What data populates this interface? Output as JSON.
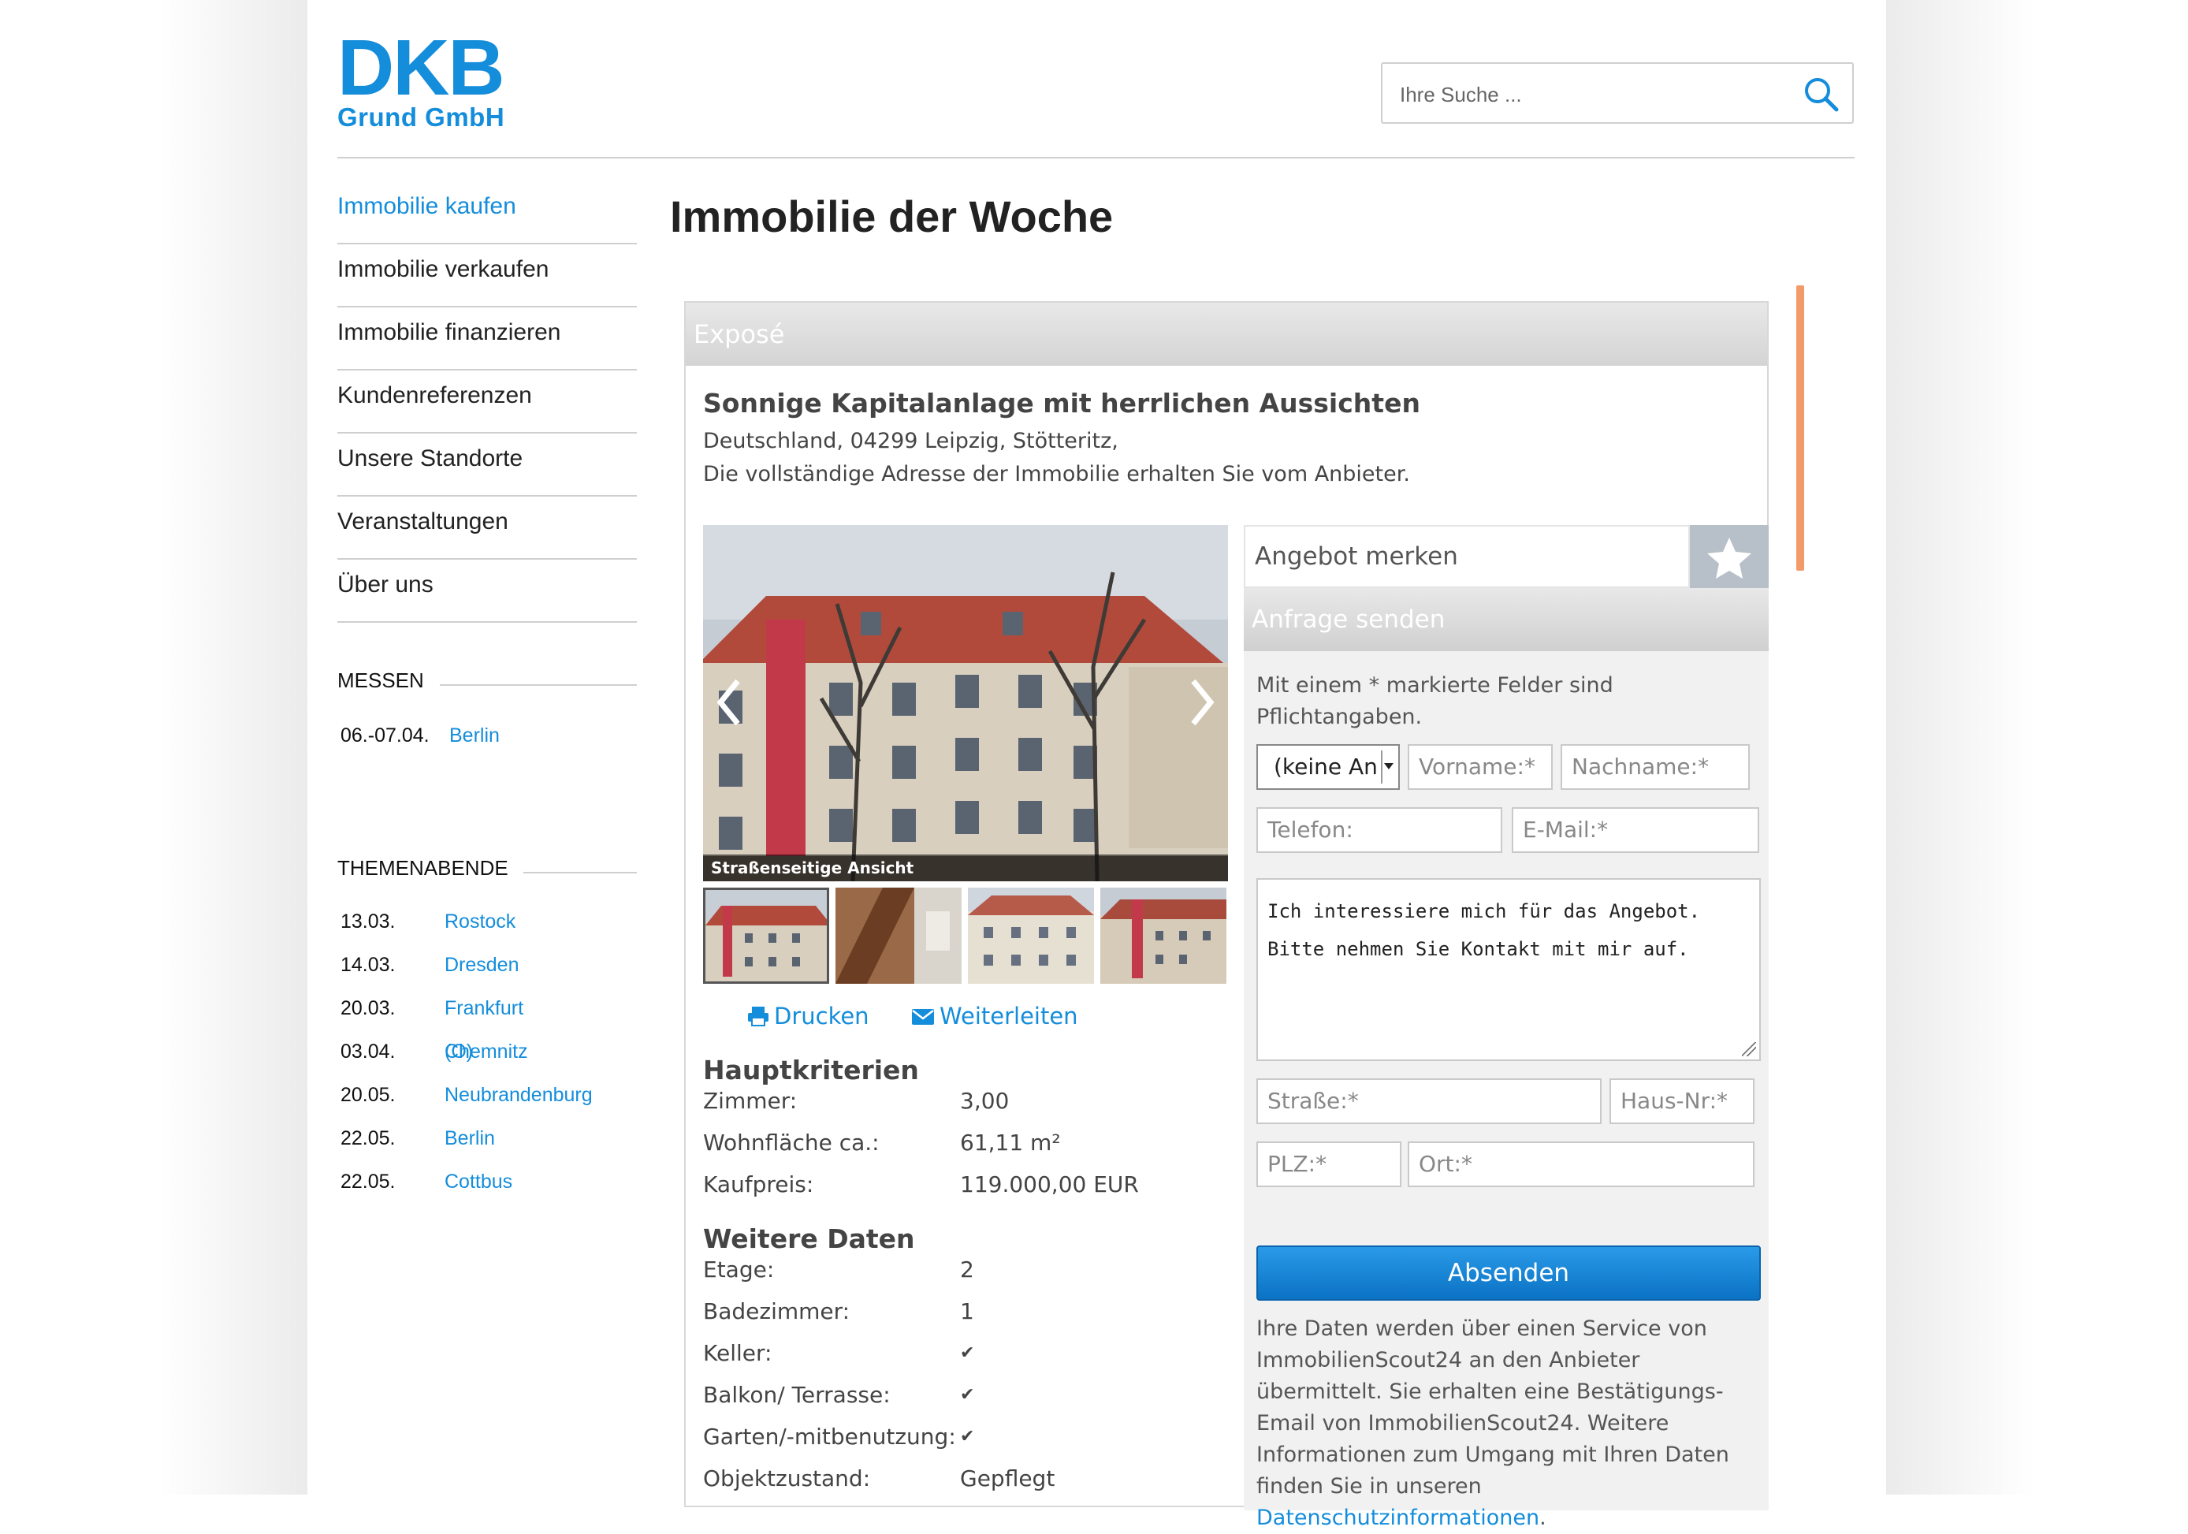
{
  "header": {
    "logo_main": "DKB",
    "logo_sub": "Grund GmbH",
    "search_placeholder": "Ihre Suche ..."
  },
  "nav": {
    "items": [
      {
        "label": "Immobilie kaufen",
        "active": true
      },
      {
        "label": "Immobilie verkaufen"
      },
      {
        "label": "Immobilie finanzieren"
      },
      {
        "label": "Kundenreferenzen"
      },
      {
        "label": "Unsere Standorte"
      },
      {
        "label": "Veranstaltungen"
      },
      {
        "label": "Über uns"
      }
    ]
  },
  "messen": {
    "heading": "MESSEN",
    "events": [
      {
        "date": "06.-07.04.",
        "city": "Berlin"
      }
    ]
  },
  "themenabende": {
    "heading": "THEMENABENDE",
    "events": [
      {
        "date": "13.03.",
        "city": "Rostock"
      },
      {
        "date": "14.03.",
        "city": "Dresden"
      },
      {
        "date": "20.03.",
        "city": "Frankfurt (O)"
      },
      {
        "date": "03.04.",
        "city": "Chemnitz"
      },
      {
        "date": "20.05.",
        "city": "Neubrandenburg"
      },
      {
        "date": "22.05.",
        "city": "Berlin"
      },
      {
        "date": "22.05.",
        "city": "Cottbus"
      }
    ]
  },
  "main": {
    "page_title": "Immobilie der Woche",
    "panel_header": "Exposé",
    "property_title": "Sonnige Kapitalanlage mit herrlichen Aussichten",
    "address": "Deutschland, 04299 Leipzig, Stötteritz,",
    "address_note": "Die vollständige Adresse der Immobilie erhalten Sie vom Anbieter.",
    "photo_caption": "Straßenseitige Ansicht",
    "print_label": "Drucken",
    "forward_label": "Weiterleiten",
    "haupt": {
      "heading": "Hauptkriterien",
      "rows": [
        {
          "key": "Zimmer:",
          "value": "3,00"
        },
        {
          "key": "Wohnfläche ca.:",
          "value": "61,11 m²"
        },
        {
          "key": "Kaufpreis:",
          "value": "119.000,00 EUR"
        }
      ]
    },
    "weitere": {
      "heading": "Weitere Daten",
      "rows": [
        {
          "key": "Etage:",
          "value": "2"
        },
        {
          "key": "Badezimmer:",
          "value": "1"
        },
        {
          "key": "Keller:",
          "value": "✔"
        },
        {
          "key": "Balkon/ Terrasse:",
          "value": "✔"
        },
        {
          "key": "Garten/-mitbenutzung:",
          "value": "✔"
        },
        {
          "key": "Objektzustand:",
          "value": "Gepflegt"
        }
      ]
    }
  },
  "contact": {
    "merken_label": "Angebot merken",
    "anfrage_label": "Anfrage senden",
    "hint": "Mit einem * markierte Felder sind Pflichtangaben.",
    "salutation_value": "(keine An",
    "vorname_placeholder": "Vorname:*",
    "nachname_placeholder": "Nachname:*",
    "telefon_placeholder": "Telefon:",
    "email_placeholder": "E-Mail:*",
    "message_line1": "Ich interessiere mich für das Angebot.",
    "message_line2": "Bitte nehmen Sie Kontakt mit mir auf.",
    "strasse_placeholder": "Straße:*",
    "hausnr_placeholder": "Haus-Nr:*",
    "plz_placeholder": "PLZ:*",
    "ort_placeholder": "Ort:*",
    "submit_label": "Absenden",
    "privacy_text": "Ihre Daten werden über einen Service von ImmobilienScout24 an den Anbieter übermittelt. Sie erhalten eine Bestätigungs-Email von ImmobilienScout24. Weitere Informationen zum Umgang mit Ihren Daten finden Sie in unseren",
    "privacy_link": "Datenschutzinformationen",
    "privacy_end": "."
  },
  "colors": {
    "brand_blue": "#148ddb",
    "accent_orange": "#f39a6b",
    "submit_blue": "#0b72c4"
  }
}
